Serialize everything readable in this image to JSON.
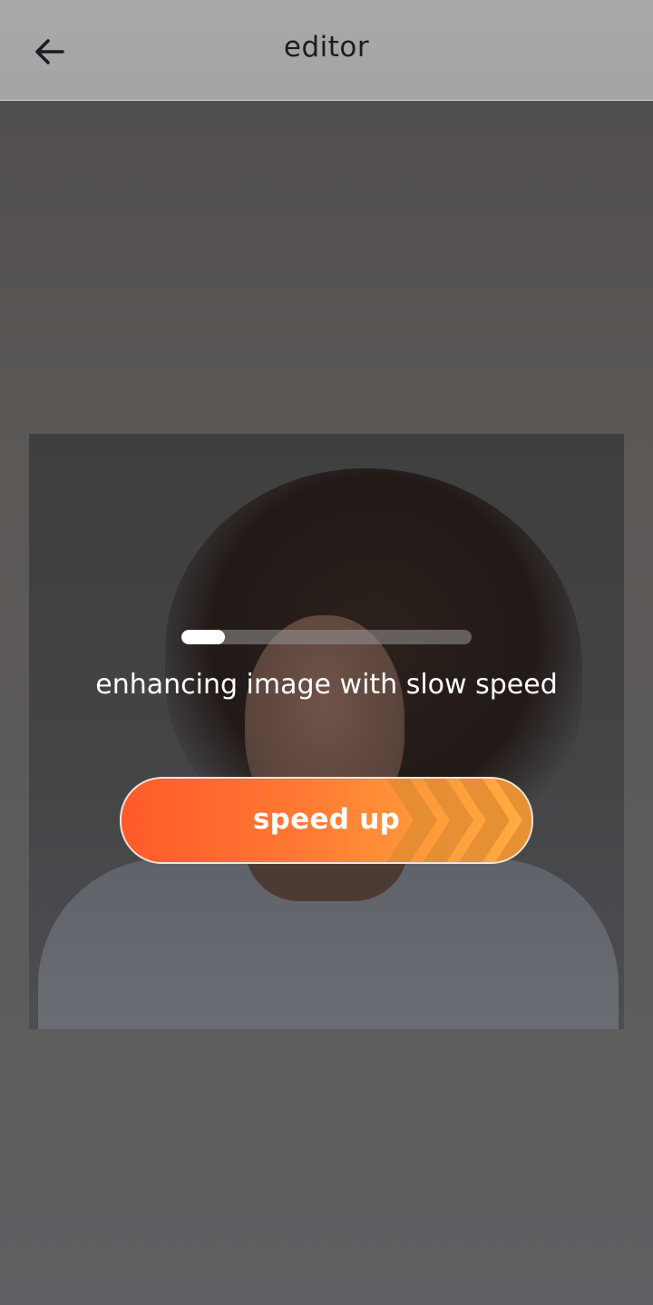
{
  "header": {
    "title": "editor",
    "back_icon": "arrow-left-icon"
  },
  "processing": {
    "progress_percent": 15,
    "status_text": "enhancing image with slow speed"
  },
  "speed_button": {
    "label": "speed up",
    "decor_icon": "chevrons-right-icon"
  },
  "colors": {
    "button_gradient_start": "#ff5a2a",
    "button_gradient_end": "#ffae42",
    "header_bg": "#a7a7a7",
    "overlay_bg": "#575554"
  }
}
